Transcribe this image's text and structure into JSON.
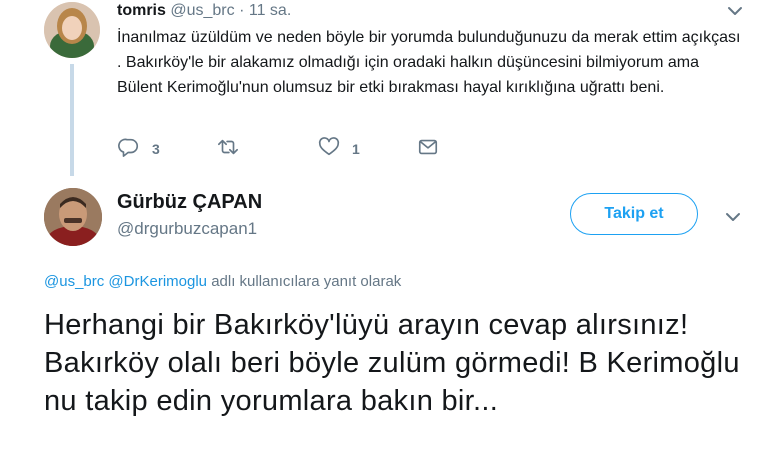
{
  "reply_tweet": {
    "author_name": "tomris",
    "author_handle": "@us_brc",
    "separator": "·",
    "time": "11 sa.",
    "text": "İnanılmaz üzüldüm ve neden böyle bir yorumda bulunduğunuzu da merak ettim açıkçası . Bakırköy'le bir alakamız olmadığı için oradaki halkın düşüncesini bilmiyorum ama Bülent Kerimoğlu'nun olumsuz bir etki bırakması hayal kırıklığına uğrattı beni.",
    "actions": {
      "reply_count": "3",
      "retweet_count": "",
      "like_count": "1"
    }
  },
  "main_tweet": {
    "author_name": "Gürbüz ÇAPAN",
    "author_handle": "@drgurbuzcapan1",
    "follow_label": "Takip et",
    "replying_to": {
      "user1": "@us_brc",
      "user2": "@DrKerimoglu",
      "suffix": "adlı kullanıcılara yanıt olarak"
    },
    "text": "Herhangi bir Bakırköy'lüyü arayın cevap alırsınız! Bakırköy olalı beri böyle zulüm görmedi! B Kerimoğlu nu takip edin yorumlara bakın bir..."
  },
  "colors": {
    "accent": "#1da1f2",
    "link": "#1b95e0",
    "muted": "#657786",
    "text": "#14171a",
    "thread_line": "#c7d9e8"
  },
  "icons": [
    "chevron-down-icon",
    "reply-icon",
    "retweet-icon",
    "like-icon",
    "direct-message-icon"
  ]
}
